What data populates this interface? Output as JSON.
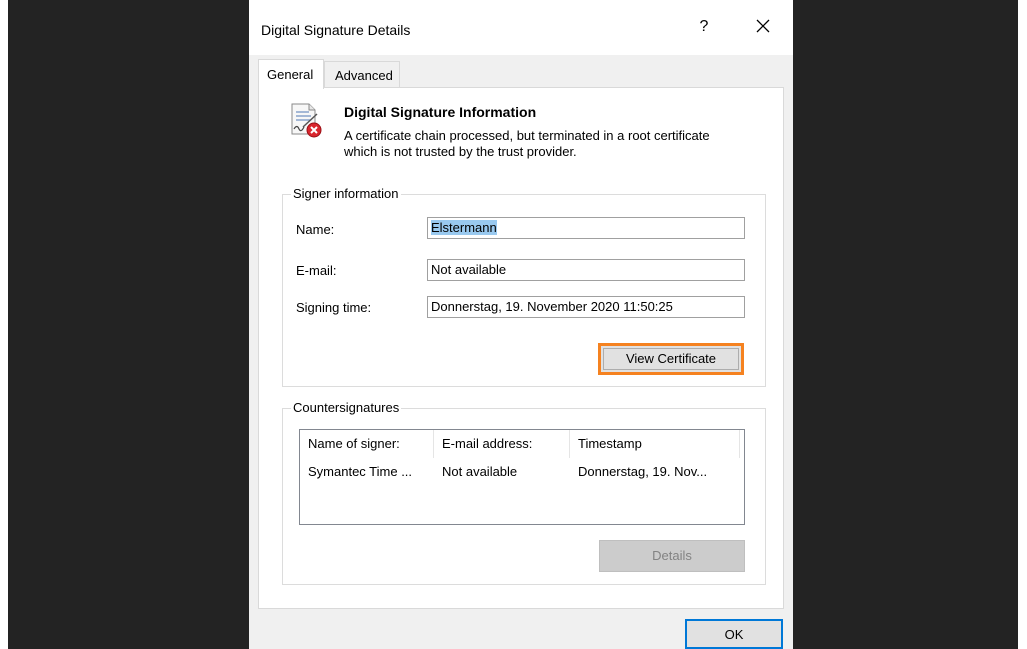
{
  "window": {
    "title": "Digital Signature Details",
    "help_label": "?"
  },
  "tabs": [
    {
      "label": "General",
      "active": true
    },
    {
      "label": "Advanced",
      "active": false
    }
  ],
  "info": {
    "icon": "signature-error-icon",
    "title": "Digital Signature Information",
    "message": "A certificate chain processed, but terminated in a root certificate which is not trusted by the trust provider."
  },
  "signer": {
    "group_label": "Signer information",
    "name_label": "Name:",
    "name_value": "Elstermann",
    "email_label": "E-mail:",
    "email_value": "Not available",
    "time_label": "Signing time:",
    "time_value": "Donnerstag, 19. November 2020 11:50:25",
    "view_cert_label": "View Certificate"
  },
  "countersignatures": {
    "group_label": "Countersignatures",
    "columns": [
      "Name of signer:",
      "E-mail address:",
      "Timestamp"
    ],
    "rows": [
      [
        "Symantec Time ...",
        "Not available",
        "Donnerstag, 19. Nov..."
      ]
    ],
    "details_label": "Details"
  },
  "footer": {
    "ok_label": "OK"
  },
  "colors": {
    "highlight": "#f58220",
    "focus": "#0078d7",
    "selection": "#99c9ef",
    "backdrop": "#232323"
  }
}
